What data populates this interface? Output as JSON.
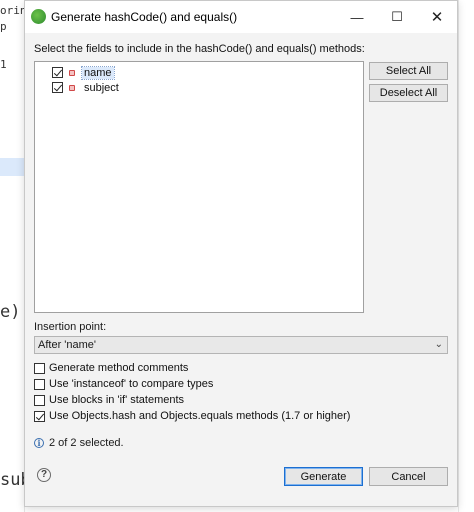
{
  "background": {
    "fragments": [
      "oring",
      "p",
      "1",
      "e)",
      "sub"
    ]
  },
  "window": {
    "title": "Generate hashCode() and equals()",
    "minimize_glyph": "—",
    "maximize_glyph": "☐",
    "close_glyph": "✕"
  },
  "fields": {
    "instruction": "Select the fields to include in the hashCode() and equals() methods:",
    "items": [
      {
        "label": "name",
        "checked": true
      },
      {
        "label": "subject",
        "checked": true
      }
    ],
    "select_all_label": "Select All",
    "deselect_all_label": "Deselect All"
  },
  "insertion": {
    "label": "Insertion point:",
    "value": "After 'name'"
  },
  "options": [
    {
      "label": "Generate method comments",
      "checked": false
    },
    {
      "label": "Use 'instanceof' to compare types",
      "checked": false
    },
    {
      "label": "Use blocks in 'if' statements",
      "checked": false
    },
    {
      "label": "Use Objects.hash and Objects.equals methods (1.7 or higher)",
      "checked": true
    }
  ],
  "status": {
    "text": "2 of 2 selected."
  },
  "footer": {
    "help_glyph": "?",
    "generate_label": "Generate",
    "cancel_label": "Cancel"
  }
}
